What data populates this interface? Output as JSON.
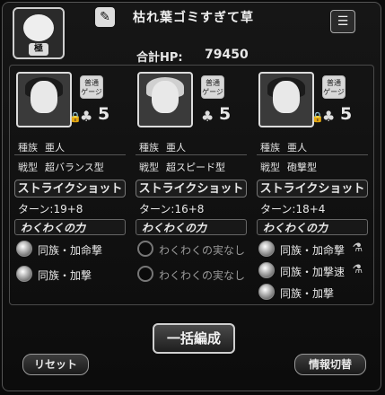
{
  "header": {
    "deck_name": "枯れ葉ゴミすぎて草",
    "avatar_badge": "極",
    "hp_label": "合計HP:",
    "hp_value": "79450",
    "menu_icon": "list-icon",
    "edit_icon": "pencil-icon"
  },
  "units": [
    {
      "badge": "普通\nゲージ",
      "luck": "5",
      "race_label": "種族",
      "race": "亜人",
      "type_label": "戦型",
      "type": "超バランス型",
      "strike_title": "ストライクショット",
      "turn": "ターン:19+8",
      "waku_title": "わくわくの力",
      "waku": [
        {
          "label": "同族・加命撃",
          "empty": false,
          "flask": false
        },
        {
          "label": "同族・加撃",
          "empty": false,
          "flask": false
        }
      ]
    },
    {
      "badge": "普通\nゲージ",
      "luck": "5",
      "race_label": "種族",
      "race": "亜人",
      "type_label": "戦型",
      "type": "超スピード型",
      "strike_title": "ストライクショット",
      "turn": "ターン:16+8",
      "waku_title": "わくわくの力",
      "waku": [
        {
          "label": "わくわくの実なし",
          "empty": true,
          "flask": false
        },
        {
          "label": "わくわくの実なし",
          "empty": true,
          "flask": false
        }
      ]
    },
    {
      "badge": "普通\nゲージ",
      "luck": "5",
      "race_label": "種族",
      "race": "亜人",
      "type_label": "戦型",
      "type": "砲撃型",
      "strike_title": "ストライクショット",
      "turn": "ターン:18+4",
      "waku_title": "わくわくの力",
      "waku": [
        {
          "label": "同族・加命撃",
          "empty": false,
          "flask": true
        },
        {
          "label": "同族・加撃速",
          "empty": false,
          "flask": true
        },
        {
          "label": "同族・加撃",
          "empty": false,
          "flask": false
        }
      ]
    }
  ],
  "buttons": {
    "bulk_edit": "一括編成",
    "reset": "リセット",
    "info_toggle": "情報切替"
  }
}
